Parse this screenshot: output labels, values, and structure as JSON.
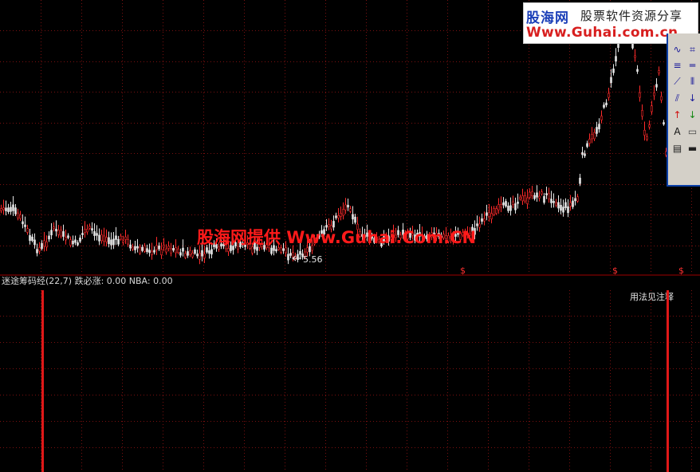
{
  "main_chart": {
    "watermark": "股海网提供 Www.Guhai.Com.CN",
    "low_label": "5.56",
    "signal_mark": "$",
    "colors": {
      "grid": "#8a1010",
      "up": "#ff2a2a",
      "down": "#e6e6e6",
      "separator": "#a00000"
    }
  },
  "indicator": {
    "header": "迷途筹码经(22,7) 跌必涨: 0.00  NBA: 0.00",
    "note": "用法见注释",
    "colors": {
      "header": "#d8d8d8",
      "bar": "#e01818"
    }
  },
  "logo": {
    "brand": "股海网",
    "slogan": "股票软件资源分享",
    "url": "Www.Guhai.com.cn"
  },
  "toolbar": {
    "icons": [
      "wave-icon",
      "gann-icon",
      "fibonacci-icon",
      "parallel-lines-icon",
      "trend-line-icon",
      "vertical-lines-icon",
      "fan-lines-icon",
      "down-arrow-icon",
      "up-arrow-icon",
      "green-down-arrow-icon",
      "text-icon",
      "rectangle-icon",
      "note-icon",
      "ruler-icon"
    ]
  }
}
